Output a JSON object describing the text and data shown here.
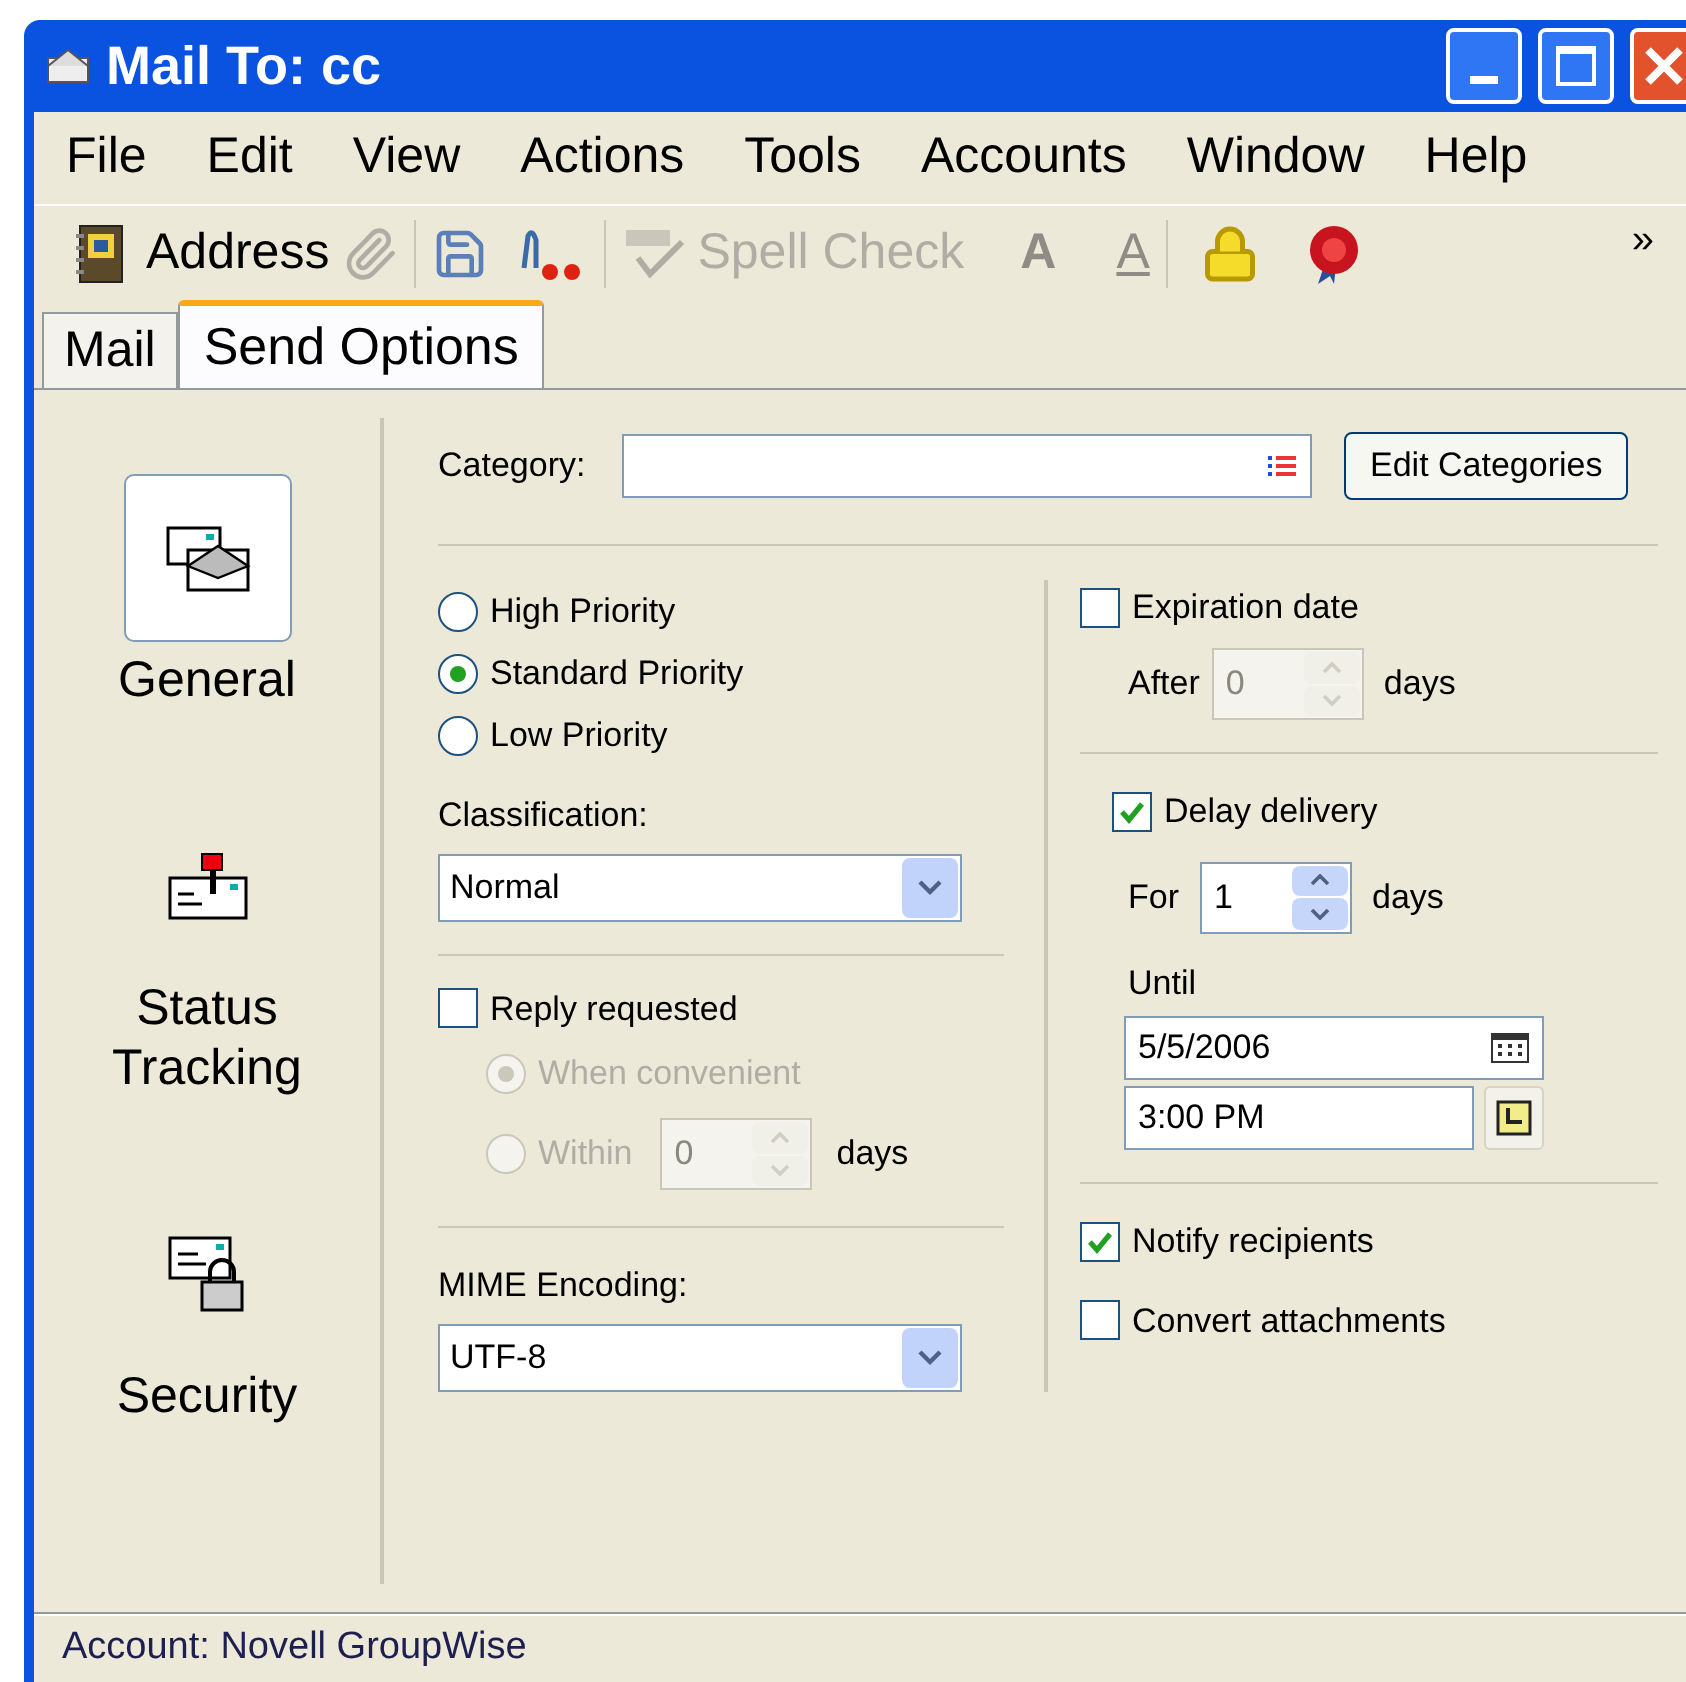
{
  "window": {
    "title": "Mail To: cc"
  },
  "menu": [
    "File",
    "Edit",
    "View",
    "Actions",
    "Tools",
    "Accounts",
    "Window",
    "Help"
  ],
  "toolbar": {
    "address": {
      "label": "Address"
    },
    "spell_check": {
      "label": "Spell Check",
      "disabled": true
    },
    "bold": {
      "label": "A",
      "disabled": true
    },
    "underline": {
      "label": "A",
      "disabled": true
    },
    "overflow": "»"
  },
  "tabs": [
    {
      "label": "Mail",
      "selected": false
    },
    {
      "label": "Send Options",
      "selected": true
    }
  ],
  "sections": [
    {
      "kind": "general",
      "label": "General",
      "selected": true
    },
    {
      "kind": "tracking",
      "label": "Status Tracking",
      "selected": false
    },
    {
      "kind": "security",
      "label": "Security",
      "selected": false
    }
  ],
  "category": {
    "label": "Category:",
    "button": "Edit Categories"
  },
  "priority": [
    {
      "label": "High Priority",
      "selected": false
    },
    {
      "label": "Standard Priority",
      "selected": true
    },
    {
      "label": "Low Priority",
      "selected": false
    }
  ],
  "classification": {
    "label": "Classification:",
    "value": "Normal"
  },
  "reply": {
    "label": "Reply requested",
    "checked": false,
    "options": [
      {
        "label": "When convenient",
        "selected": true,
        "disabled": true
      },
      {
        "label": "Within",
        "selected": false,
        "disabled": true,
        "value": "0",
        "unit": "days"
      }
    ]
  },
  "mime": {
    "label": "MIME Encoding:",
    "value": "UTF-8"
  },
  "expiration": {
    "label": "Expiration date",
    "checked": false,
    "prefix": "After",
    "value": "0",
    "unit": "days",
    "disabled": true
  },
  "delay": {
    "label": "Delay delivery",
    "checked": true,
    "prefix": "For",
    "value": "1",
    "unit": "days",
    "disabled": false,
    "until_label": "Until",
    "date": "5/5/2006",
    "time": "3:00 PM"
  },
  "notify": [
    {
      "label": "Notify recipients",
      "checked": true
    },
    {
      "label": "Convert attachments",
      "checked": false
    }
  ],
  "status_bar": "Account: Novell GroupWise"
}
